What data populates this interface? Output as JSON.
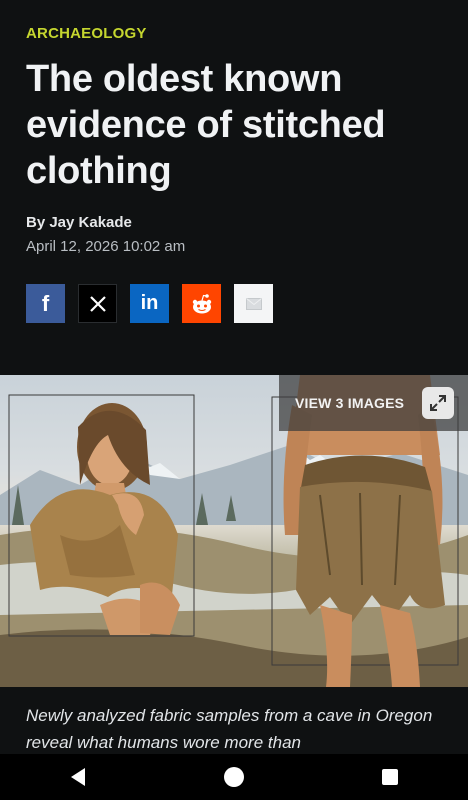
{
  "article": {
    "category": "ARCHAEOLOGY",
    "headline": "The oldest known evidence of stitched clothing",
    "byline": "By Jay Kakade",
    "date": "April 12, 2026 10:02 am",
    "dek": "Newly analyzed fabric samples from a cave in Oregon reveal what humans wore more than"
  },
  "share": {
    "buttons": [
      {
        "name": "facebook",
        "icon": "facebook-icon",
        "color": "#3b5b9a"
      },
      {
        "name": "x",
        "icon": "x-icon",
        "color": "#000000"
      },
      {
        "name": "linkedin",
        "icon": "linkedin-icon",
        "color": "#0a66c2"
      },
      {
        "name": "reddit",
        "icon": "reddit-icon",
        "color": "#ff4500"
      },
      {
        "name": "email",
        "icon": "email-icon",
        "color": "#f4f5f6"
      }
    ],
    "facebook_glyph": "f",
    "linkedin_glyph": "in"
  },
  "hero": {
    "view_images_label": "VIEW 3 IMAGES",
    "expand_icon": "expand-icon"
  },
  "navbar": {
    "back_icon": "back-triangle-icon",
    "home_icon": "home-circle-icon",
    "recents_icon": "recents-square-icon"
  },
  "colors": {
    "background": "#0f1112",
    "category": "#c5d62f"
  }
}
